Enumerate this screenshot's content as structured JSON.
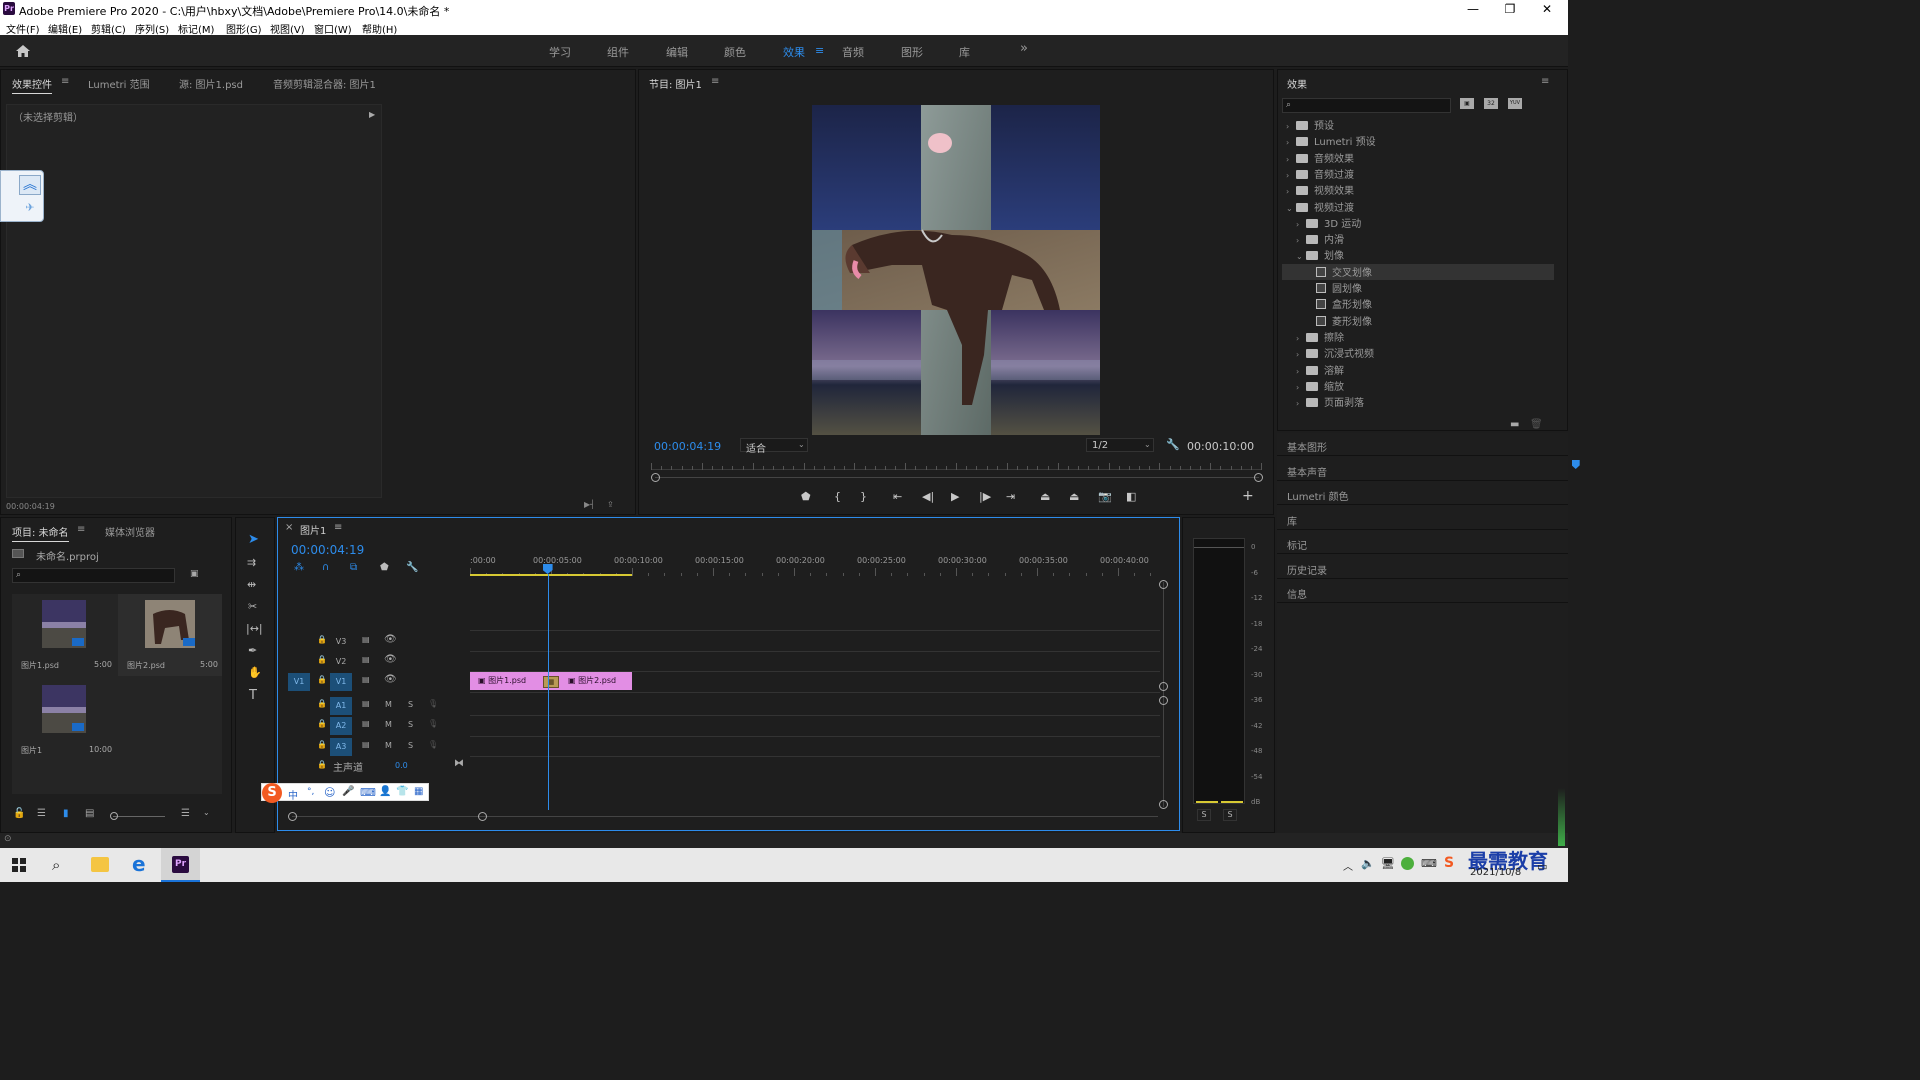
{
  "window": {
    "title": "Adobe Premiere Pro 2020 - C:\\用户\\hbxy\\文档\\Adobe\\Premiere Pro\\14.0\\未命名 *",
    "app_icon": "Pr",
    "minimize": "—",
    "restore": "❐",
    "close": "✕"
  },
  "menu": [
    "文件(F)",
    "编辑(E)",
    "剪辑(C)",
    "序列(S)",
    "标记(M)",
    "图形(G)",
    "视图(V)",
    "窗口(W)",
    "帮助(H)"
  ],
  "workspaces": {
    "items": [
      "学习",
      "组件",
      "编辑",
      "颜色",
      "效果",
      "音频",
      "图形",
      "库"
    ],
    "active_index": 4,
    "more": "»",
    "menu_icon": "≡"
  },
  "effect_controls": {
    "tabs": [
      "效果控件",
      "Lumetri 范围",
      "源: 图片1.psd",
      "音频剪辑混合器: 图片1"
    ],
    "menu_icon": "≡",
    "no_clip": "（未选择剪辑）",
    "timecode": "00:00:04:19"
  },
  "program_monitor": {
    "title": "节目: 图片1",
    "menu_icon": "≡",
    "timecode": "00:00:04:19",
    "fit": "适合",
    "resolution": "1/2",
    "duration": "00:00:10:00",
    "playhead_fraction": 0.47
  },
  "effects_panel": {
    "title": "效果",
    "menu_icon": "≡",
    "search_placeholder": "",
    "tree": [
      {
        "label": "预设",
        "level": 0,
        "kind": "special",
        "expanded": false
      },
      {
        "label": "Lumetri 预设",
        "level": 0,
        "kind": "special",
        "expanded": false
      },
      {
        "label": "音频效果",
        "level": 0,
        "kind": "folder",
        "expanded": false
      },
      {
        "label": "音频过渡",
        "level": 0,
        "kind": "folder",
        "expanded": false
      },
      {
        "label": "视频效果",
        "level": 0,
        "kind": "folder",
        "expanded": false
      },
      {
        "label": "视频过渡",
        "level": 0,
        "kind": "folder",
        "expanded": true
      },
      {
        "label": "3D 运动",
        "level": 1,
        "kind": "folder",
        "expanded": false
      },
      {
        "label": "内滑",
        "level": 1,
        "kind": "folder",
        "expanded": false
      },
      {
        "label": "划像",
        "level": 1,
        "kind": "folder",
        "expanded": true
      },
      {
        "label": "交叉划像",
        "level": 2,
        "kind": "effect",
        "selected": true
      },
      {
        "label": "圆划像",
        "level": 2,
        "kind": "effect"
      },
      {
        "label": "盒形划像",
        "level": 2,
        "kind": "effect"
      },
      {
        "label": "菱形划像",
        "level": 2,
        "kind": "effect"
      },
      {
        "label": "擦除",
        "level": 1,
        "kind": "folder",
        "expanded": false
      },
      {
        "label": "沉浸式视频",
        "level": 1,
        "kind": "folder",
        "expanded": false
      },
      {
        "label": "溶解",
        "level": 1,
        "kind": "folder",
        "expanded": false
      },
      {
        "label": "缩放",
        "level": 1,
        "kind": "folder",
        "expanded": false
      },
      {
        "label": "页面剥落",
        "level": 1,
        "kind": "folder",
        "expanded": false
      }
    ],
    "filter_badges": [
      "32",
      "YUV"
    ]
  },
  "side_panels": [
    "基本图形",
    "基本声音",
    "Lumetri 颜色",
    "库",
    "标记",
    "历史记录",
    "信息"
  ],
  "project": {
    "tabs": [
      "项目: 未命名",
      "媒体浏览器"
    ],
    "menu_icon": "≡",
    "file": "未命名.prproj",
    "items": [
      {
        "name": "图片1.psd",
        "duration": "5:00"
      },
      {
        "name": "图片2.psd",
        "duration": "5:00"
      },
      {
        "name": "图片1",
        "duration": "10:00"
      }
    ]
  },
  "timeline": {
    "title": "图片1",
    "close": "×",
    "menu_icon": "≡",
    "timecode": "00:00:04:19",
    "ruler": [
      ":00:00",
      "00:00:05:00",
      "00:00:10:00",
      "00:00:15:00",
      "00:00:20:00",
      "00:00:25:00",
      "00:00:30:00",
      "00:00:35:00",
      "00:00:40:00"
    ],
    "video_tracks": [
      "V3",
      "V2",
      "V1"
    ],
    "audio_tracks": [
      "A1",
      "A2",
      "A3"
    ],
    "source_patch": "V1",
    "mute": "M",
    "solo": "S",
    "master_label": "主声道",
    "master_value": "0.0",
    "clips": [
      "图片1.psd",
      "图片2.psd"
    ],
    "transition": "交叉划像",
    "playhead_seconds": 4.79
  },
  "audio_meter": {
    "scale": [
      "0",
      "-6",
      "-12",
      "-18",
      "-24",
      "-30",
      "-36",
      "-42",
      "-48",
      "-54",
      "dB"
    ],
    "solo_buttons": [
      "S",
      "S"
    ]
  },
  "ime_toolbar": [
    "S",
    "中",
    "°,",
    "☺",
    "🎤",
    "⌨",
    "👤",
    "👕",
    "▦"
  ],
  "taskbar": {
    "date": "2021/10/8",
    "watermark": "最需教育"
  }
}
